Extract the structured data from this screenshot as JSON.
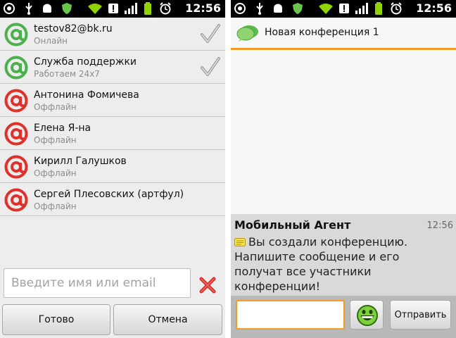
{
  "status_bar": {
    "time": "12:56",
    "icons": [
      "agent-icon",
      "usb-icon",
      "android-debug-icon",
      "shield-icon",
      "wifi-icon",
      "notification-icon",
      "signal-icon",
      "battery-icon",
      "alarm-icon"
    ]
  },
  "contacts_screen": {
    "contacts": [
      {
        "name": "testov82@bk.ru",
        "status": "Онлайн",
        "online": true,
        "selected": true
      },
      {
        "name": "Служба поддержки",
        "status": "Работаем 24х7",
        "online": true,
        "selected": true
      },
      {
        "name": "Антонина Фомичева",
        "status": "Оффлайн",
        "online": false,
        "selected": false
      },
      {
        "name": "Елена Я-на",
        "status": "Оффлайн",
        "online": false,
        "selected": false
      },
      {
        "name": "Кирилл Галушков",
        "status": "Оффлайн",
        "online": false,
        "selected": false
      },
      {
        "name": "Сергей Плесовских (артфул)",
        "status": "Оффлайн",
        "online": false,
        "selected": false
      }
    ],
    "search": {
      "placeholder": "Введите имя или email",
      "value": ""
    },
    "buttons": {
      "done": "Готово",
      "cancel": "Отмена"
    }
  },
  "conference_screen": {
    "title": "Новая конференция 1",
    "message": {
      "sender": "Мобильный Агент",
      "time": "12:56",
      "text": "Вы создали конференцию. Напишите сообщение и его получат все участники конференции!"
    },
    "input": {
      "value": ""
    },
    "send_label": "Отправить"
  },
  "colors": {
    "online": "#4cb04c",
    "offline": "#e0302a",
    "accent": "#f39a2b",
    "statusbar": "#000000"
  }
}
